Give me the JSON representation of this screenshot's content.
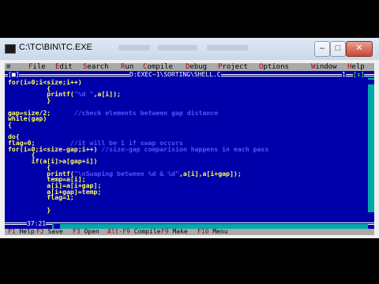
{
  "window": {
    "title": "C:\\TC\\BIN\\TC.EXE",
    "controls": {
      "minimize": "–",
      "maximize": "□",
      "close": "✕"
    }
  },
  "menu": {
    "system": "≡",
    "items": [
      "File",
      "Edit",
      "Search",
      "Run",
      "Compile",
      "Debug",
      "Project",
      "Options",
      "Window",
      "Help"
    ]
  },
  "editor": {
    "close_box": "[■]",
    "filename": "D:EXEC~1\\SORTING\\SHELL.C",
    "window_number": "1",
    "zoom_box": "[↕]",
    "cursor_position": "37:21",
    "code_lines": [
      [
        {
          "t": "for(i=0;i<size;i++)",
          "c": "y"
        }
      ],
      [
        {
          "t": "          {",
          "c": "y"
        }
      ],
      [
        {
          "t": "          printf(",
          "c": "y"
        },
        {
          "t": "\"%d \"",
          "c": "c"
        },
        {
          "t": ",a[i]);",
          "c": "y"
        }
      ],
      [
        {
          "t": "          }",
          "c": "y"
        }
      ],
      [
        {
          "t": "",
          "c": "y"
        }
      ],
      [
        {
          "t": "gap=size/2; ",
          "c": "y"
        },
        {
          "t": "     //check elements between gap distance",
          "c": "c"
        }
      ],
      [
        {
          "t": "while(gap)",
          "c": "y"
        }
      ],
      [
        {
          "t": "{",
          "c": "y"
        }
      ],
      [
        {
          "t": "",
          "c": "y"
        }
      ],
      [
        {
          "t": "do{",
          "c": "y"
        }
      ],
      [
        {
          "t": "flag=0;",
          "c": "y"
        },
        {
          "t": "         //it will be 1 if swap occurs",
          "c": "c"
        }
      ],
      [
        {
          "t": "for(i=0;i<size-gap;i++) ",
          "c": "y"
        },
        {
          "t": "//size-gap comparision happens in each pass",
          "c": "c"
        }
      ],
      [
        {
          "t": "      {",
          "c": "y"
        }
      ],
      [
        {
          "t": "      if(a[i]>a[gap+i])",
          "c": "y"
        }
      ],
      [
        {
          "t": "          {",
          "c": "y"
        }
      ],
      [
        {
          "t": "          printf(",
          "c": "y"
        },
        {
          "t": "\"\\nSwaping between %d & %d\"",
          "c": "c"
        },
        {
          "t": ",a[i],a[i+gap]);",
          "c": "y"
        }
      ],
      [
        {
          "t": "          temp=a[i];",
          "c": "y"
        }
      ],
      [
        {
          "t": "          a[i]=a[i+gap];",
          "c": "y"
        }
      ],
      [
        {
          "t": "          a[i+gap]=temp;",
          "c": "y"
        }
      ],
      [
        {
          "t": "          flag=1;",
          "c": "y"
        }
      ],
      [
        {
          "t": "",
          "c": "y"
        }
      ],
      [
        {
          "t": "          }",
          "c": "y"
        }
      ]
    ]
  },
  "statusbar": {
    "items": [
      {
        "key": "F1",
        "label": "Help"
      },
      {
        "key": "F2",
        "label": "Save"
      },
      {
        "key": "F3",
        "label": "Open"
      },
      {
        "key": "Alt-F9",
        "label": "Compile"
      },
      {
        "key": "F9",
        "label": "Make"
      },
      {
        "key": "F10",
        "label": "Menu"
      }
    ]
  },
  "colors": {
    "dos_blue": "#0000aa",
    "menu_gray": "#aaaaaa",
    "code_yellow": "#ffff55",
    "comment_blue": "#5555ff",
    "hotkey_red": "#aa0000"
  }
}
